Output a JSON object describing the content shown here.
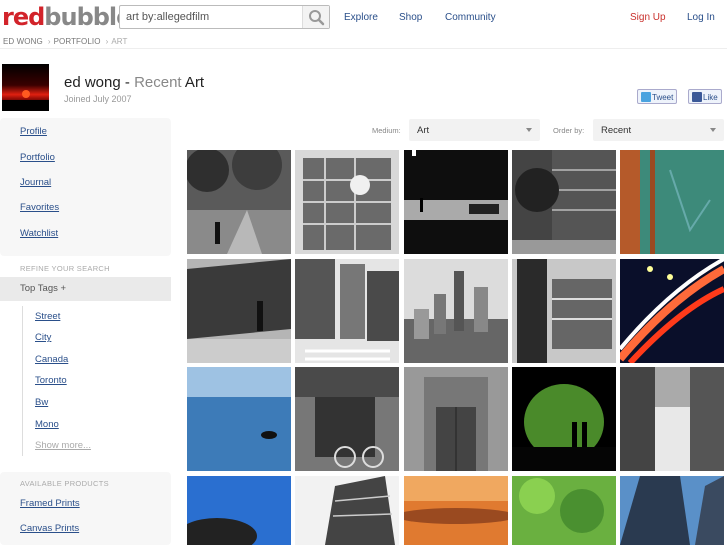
{
  "header": {
    "logo_red": "red",
    "logo_grey": "bubble",
    "search_value": "art by:allegedfilm",
    "nav": {
      "explore": "Explore",
      "shop": "Shop",
      "community": "Community"
    },
    "signup": "Sign Up",
    "login": "Log In"
  },
  "breadcrumb": {
    "user": "ED WONG",
    "portfolio": "PORTFOLIO",
    "current": "ART"
  },
  "profile": {
    "name": "ed wong",
    "dash": " - ",
    "recent": "Recent",
    "art": " Art",
    "joined": "Joined July 2007",
    "tweet": "Tweet",
    "like": "Like"
  },
  "sidebar": {
    "links": [
      "Profile",
      "Portfolio",
      "Journal",
      "Favorites",
      "Watchlist"
    ],
    "refine_label": "REFINE YOUR SEARCH",
    "top_tags": "Top Tags +",
    "tags": [
      "Street",
      "City",
      "Canada",
      "Toronto",
      "Bw",
      "Mono"
    ],
    "show_more": "Show more...",
    "products_label": "AVAILABLE PRODUCTS",
    "products": [
      "Framed Prints",
      "Canvas Prints"
    ]
  },
  "controls": {
    "medium_label": "Medium:",
    "medium_value": "Art",
    "order_label": "Order by:",
    "order_value": "Recent"
  },
  "colors": {
    "brand_red": "#d2232a",
    "link_blue": "#2a4f8a"
  }
}
